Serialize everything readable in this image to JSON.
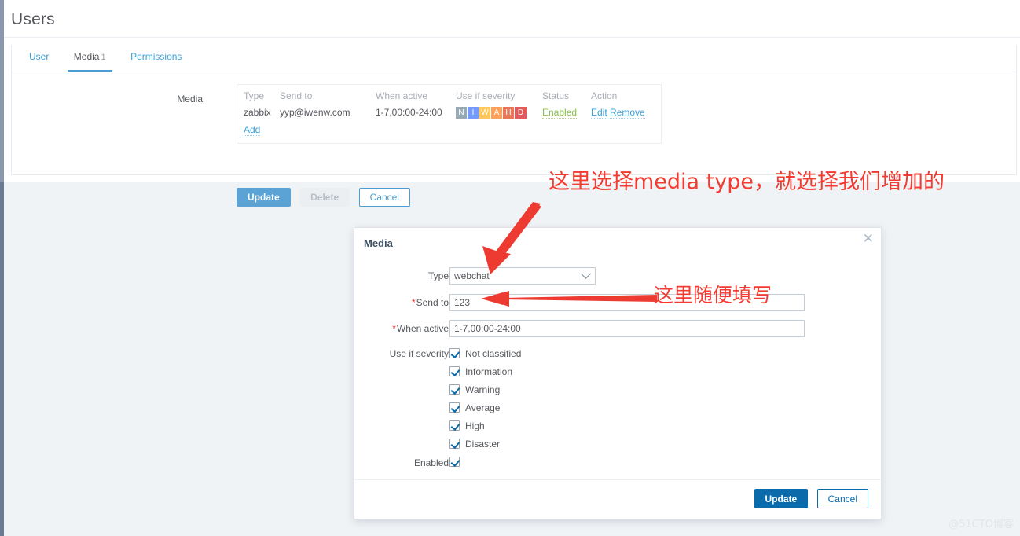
{
  "page": {
    "title": "Users"
  },
  "tabs": [
    {
      "label": "User",
      "count": ""
    },
    {
      "label": "Media",
      "count": "1"
    },
    {
      "label": "Permissions",
      "count": ""
    }
  ],
  "media_form": {
    "label": "Media",
    "columns": [
      "Type",
      "Send to",
      "When active",
      "Use if severity",
      "Status",
      "Action"
    ],
    "row": {
      "type": "zabbix",
      "send_to": "yyp@iwenw.com",
      "when_active": "1-7,00:00-24:00",
      "severity": [
        {
          "letter": "N",
          "color": "#97aab3"
        },
        {
          "letter": "I",
          "color": "#7499ff"
        },
        {
          "letter": "W",
          "color": "#ffc859"
        },
        {
          "letter": "A",
          "color": "#ffa059"
        },
        {
          "letter": "H",
          "color": "#e97659"
        },
        {
          "letter": "D",
          "color": "#e45959"
        }
      ],
      "status": "Enabled",
      "action_edit": "Edit",
      "action_remove": "Remove"
    },
    "add_link": "Add",
    "buttons": {
      "update": "Update",
      "delete": "Delete",
      "cancel": "Cancel"
    }
  },
  "modal": {
    "title": "Media",
    "close_icon": "close-icon",
    "fields": {
      "type_label": "Type",
      "type_value": "webchat",
      "send_to_label": "Send to",
      "send_to_value": "123",
      "when_active_label": "When active",
      "when_active_value": "1-7,00:00-24:00",
      "severity_label": "Use if severity",
      "enabled_label": "Enabled",
      "required_mark": "*"
    },
    "severities": [
      "Not classified",
      "Information",
      "Warning",
      "Average",
      "High",
      "Disaster"
    ],
    "buttons": {
      "update": "Update",
      "cancel": "Cancel"
    }
  },
  "annotations": {
    "note_type": "这里选择media type，就选择我们增加的",
    "note_sendto": "这里随便填写",
    "arrow_color": "#ee3b32"
  },
  "watermark": "@51CTO博客",
  "colors": {
    "accent_light": "#5ba3d4",
    "accent_dark": "#0b6aa9",
    "link": "#3b9fd6",
    "status_green": "#86bf4b",
    "annotation_red": "#f43b32"
  }
}
